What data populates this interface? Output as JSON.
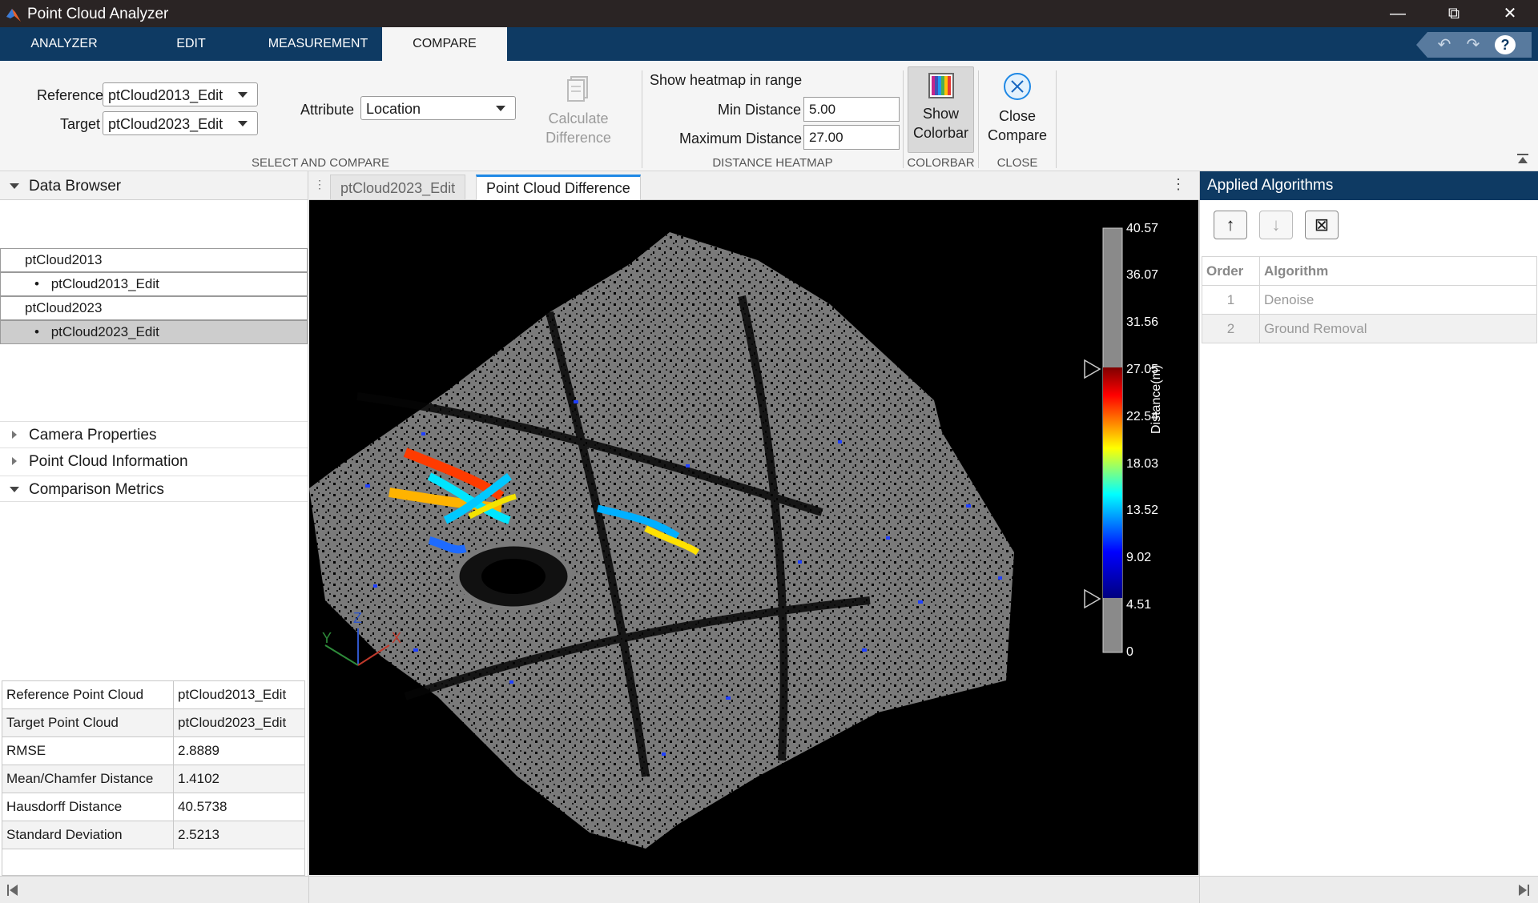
{
  "window": {
    "title": "Point Cloud Analyzer",
    "controls": [
      "minimize",
      "restore",
      "close"
    ]
  },
  "ribbon": {
    "tabs": [
      "ANALYZER",
      "EDIT",
      "MEASUREMENT",
      "COMPARE"
    ],
    "active_tab": "COMPARE",
    "quick_access": [
      "undo-icon",
      "redo-icon",
      "help-icon"
    ],
    "select_compare": {
      "reference_label": "Reference",
      "reference_value": "ptCloud2013_Edit",
      "target_label": "Target",
      "target_value": "ptCloud2023_Edit",
      "attribute_label": "Attribute",
      "attribute_value": "Location",
      "calculate_label_1": "Calculate",
      "calculate_label_2": "Difference",
      "section_label": "SELECT AND COMPARE"
    },
    "heatmap": {
      "title": "Show heatmap in range",
      "min_label": "Min Distance",
      "min_value": "5.00",
      "max_label": "Maximum Distance",
      "max_value": "27.00",
      "section_label": "DISTANCE HEATMAP"
    },
    "colorbar": {
      "label_1": "Show",
      "label_2": "Colorbar",
      "section_label": "COLORBAR"
    },
    "close": {
      "label_1": "Close",
      "label_2": "Compare",
      "section_label": "CLOSE"
    }
  },
  "left_panel": {
    "data_browser": "Data Browser",
    "tree": [
      {
        "label": "ptCloud2013",
        "level": 0,
        "selected": false
      },
      {
        "label": "ptCloud2013_Edit",
        "level": 1,
        "selected": false
      },
      {
        "label": "ptCloud2023",
        "level": 0,
        "selected": false
      },
      {
        "label": "ptCloud2023_Edit",
        "level": 1,
        "selected": true
      }
    ],
    "camera_properties": "Camera Properties",
    "point_cloud_information": "Point Cloud Information",
    "comparison_metrics": "Comparison Metrics",
    "metrics": [
      {
        "name": "Reference Point Cloud",
        "value": "ptCloud2013_Edit"
      },
      {
        "name": "Target Point Cloud",
        "value": "ptCloud2023_Edit"
      },
      {
        "name": "RMSE",
        "value": "2.8889"
      },
      {
        "name": "Mean/Chamfer Distance",
        "value": "1.4102"
      },
      {
        "name": "Hausdorff Distance",
        "value": "40.5738"
      },
      {
        "name": "Standard Deviation",
        "value": "2.5213"
      }
    ]
  },
  "document_tabs": [
    {
      "label": "ptCloud2023_Edit",
      "active": false
    },
    {
      "label": "Point Cloud Difference",
      "active": true
    }
  ],
  "viewport": {
    "colorbar_label": "Distance(m)",
    "colorbar_ticks": [
      "40.57",
      "36.07",
      "31.56",
      "27.05",
      "22.54",
      "18.03",
      "13.52",
      "9.02",
      "4.51",
      "0"
    ],
    "colorbar_range": [
      0,
      40.57
    ],
    "heatmap_range": [
      5.0,
      27.0
    ],
    "axes": {
      "x": "X",
      "y": "Y",
      "z": "Z"
    },
    "colors": {
      "background": "#000000",
      "points": "#7a7a7a",
      "x_axis": "#c0392b",
      "y_axis": "#2e8b3a",
      "z_axis": "#2f55c9"
    }
  },
  "right_panel": {
    "title": "Applied Algorithms",
    "buttons": [
      "move-up-icon",
      "move-down-icon",
      "delete-icon"
    ],
    "columns": [
      "Order",
      "Algorithm"
    ],
    "rows": [
      {
        "order": "1",
        "algorithm": "Denoise"
      },
      {
        "order": "2",
        "algorithm": "Ground Removal"
      }
    ]
  },
  "colors": {
    "ribbon_blue": "#0e3a63",
    "accent": "#1e88e5"
  }
}
